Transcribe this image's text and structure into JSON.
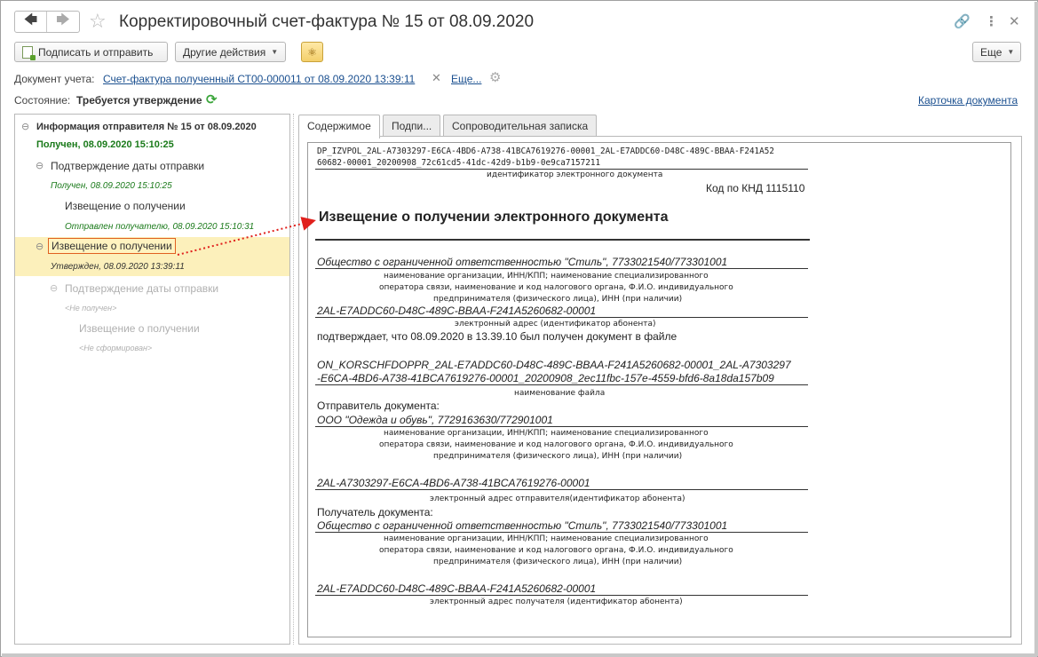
{
  "window": {
    "title": "Корректировочный счет-фактура № 15 от 08.09.2020"
  },
  "toolbar": {
    "sign_send": "Подписать и отправить",
    "other_actions": "Другие действия",
    "more": "Еще"
  },
  "info": {
    "doc_label": "Документ учета:",
    "doc_link": "Счет-фактура полученный СТ00-000011 от 08.09.2020 13:39:11",
    "more_link": "Еще...",
    "state_label": "Состояние:",
    "state_value": "Требуется утверждение",
    "card_link": "Карточка документа"
  },
  "tree": {
    "items": [
      {
        "text": "Информация отправителя № 15 от 08.09.2020"
      },
      {
        "text": "Получен, 08.09.2020 15:10:25"
      },
      {
        "text": "Подтверждение даты отправки"
      },
      {
        "text": "Получен, 08.09.2020 15:10:25"
      },
      {
        "text": "Извещение о получении"
      },
      {
        "text": "Отправлен получателю, 08.09.2020 15:10:31"
      },
      {
        "text": "Извещение о получении"
      },
      {
        "text": "Утвержден, 08.09.2020 13:39:11"
      },
      {
        "text": "Подтверждение даты отправки"
      },
      {
        "text": "<Не получен>"
      },
      {
        "text": "Извещение о получении"
      },
      {
        "text": "<Не сформирован>"
      }
    ]
  },
  "tabs": [
    {
      "label": "Содержимое"
    },
    {
      "label": "Подпи..."
    },
    {
      "label": "Сопроводительная записка"
    }
  ],
  "document": {
    "id_line1": "DP_IZVPOL_2AL-A7303297-E6CA-4BD6-A738-41BCA7619276-00001_2AL-E7ADDC60-D48C-489C-BBAA-F241A52",
    "id_line2": "60682-00001_20200908_72c61cd5-41dc-42d9-b1b9-0e9ca7157211",
    "id_caption": "идентификатор электронного документа",
    "knd": "Код по КНД 1115110",
    "heading": "Извещение о получении электронного документа",
    "org1": "Общество с ограниченной ответственностью \"Стиль\", 7733021540/773301001",
    "org_caption1": "наименование организации, ИНН/КПП; наименование специализированного",
    "org_caption2": "оператора связи, наименование и код налогового органа, Ф.И.О. индивидуального",
    "org_caption3": "предпринимателя (физического лица), ИНН (при наличии)",
    "addr1": "2AL-E7ADDC60-D48C-489C-BBAA-F241A5260682-00001",
    "addr_caption1": "электронный адрес (идентификатор абонента)",
    "confirm": "подтверждает, что 08.09.2020 в 13.39.10 был получен документ в файле",
    "file1": "ON_KORSCHFDOPPR_2AL-E7ADDC60-D48C-489C-BBAA-F241A5260682-00001_2AL-A7303297",
    "file2": "-E6CA-4BD6-A738-41BCA7619276-00001_20200908_2ec11fbc-157e-4559-bfd6-8a18da157b09",
    "file_caption": "наименование файла",
    "sender_label": "Отправитель документа:",
    "sender": "ООО \"Одежда и обувь\", 7729163630/772901001",
    "sender_caption1": "наименование организации, ИНН/КПП; наименование специализированного",
    "sender_caption2": "оператора связи, наименование и код налогового органа, Ф.И.О. индивидуального",
    "sender_caption3": "предпринимателя (физического лица), ИНН (при наличии)",
    "sender_addr": "2AL-A7303297-E6CA-4BD6-A738-41BCA7619276-00001",
    "sender_addr_caption": "электронный адрес отправителя(идентификатор абонента)",
    "receiver_label": "Получатель документа:",
    "receiver": "Общество с ограниченной ответственностью \"Стиль\", 7733021540/773301001",
    "receiver_caption1": "наименование организации, ИНН/КПП; наименование специализированного",
    "receiver_caption2": "оператора связи, наименование и код налогового органа, Ф.И.О. индивидуального",
    "receiver_caption3": "предпринимателя (физического лица), ИНН (при наличии)",
    "receiver_addr": "2AL-E7ADDC60-D48C-489C-BBAA-F241A5260682-00001",
    "receiver_addr_caption": "электронный адрес получателя (идентификатор абонента)"
  },
  "icons": {
    "back": "arrow-left-icon",
    "forward": "arrow-right-icon",
    "star": "star-icon",
    "link": "link-icon",
    "menu": "more-vertical-icon",
    "close": "close-icon",
    "refresh": "refresh-icon",
    "gear": "gear-icon"
  },
  "colors": {
    "selection": "#fcf0bb",
    "green_status": "#1a7a1a",
    "link": "#1a4f8f",
    "arrow": "#e0201c"
  }
}
